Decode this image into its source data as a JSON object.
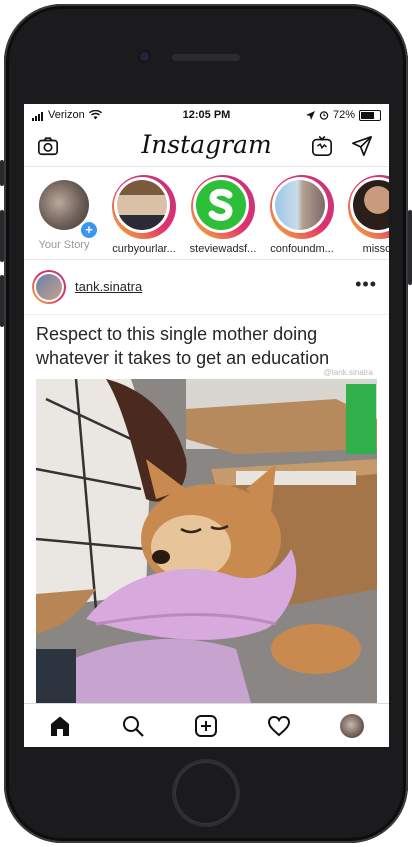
{
  "status_bar": {
    "carrier": "Verizon",
    "time": "12:05 PM",
    "battery_percent": "72%",
    "battery_level": 0.72
  },
  "header": {
    "logo": "Instagram",
    "left_icon": "camera-icon",
    "right_icons": [
      "igtv-icon",
      "direct-message-icon"
    ]
  },
  "stories": [
    {
      "label": "Your Story",
      "own": true
    },
    {
      "label": "curbyourlar..."
    },
    {
      "label": "steviewadsf..."
    },
    {
      "label": "confoundm..."
    },
    {
      "label": "missop"
    }
  ],
  "post": {
    "username": "tank.sinatra",
    "more_label": "•••",
    "caption": "Respect to this single mother doing whatever it takes to get an education",
    "watermark": "@tank.sinatra"
  },
  "bottom_nav": [
    "home-icon",
    "search-icon",
    "new-post-icon",
    "activity-icon",
    "profile-icon"
  ],
  "colors": {
    "accent": "#3897f0",
    "story_ring_start": "#f7b733",
    "story_ring_end": "#c13584"
  }
}
